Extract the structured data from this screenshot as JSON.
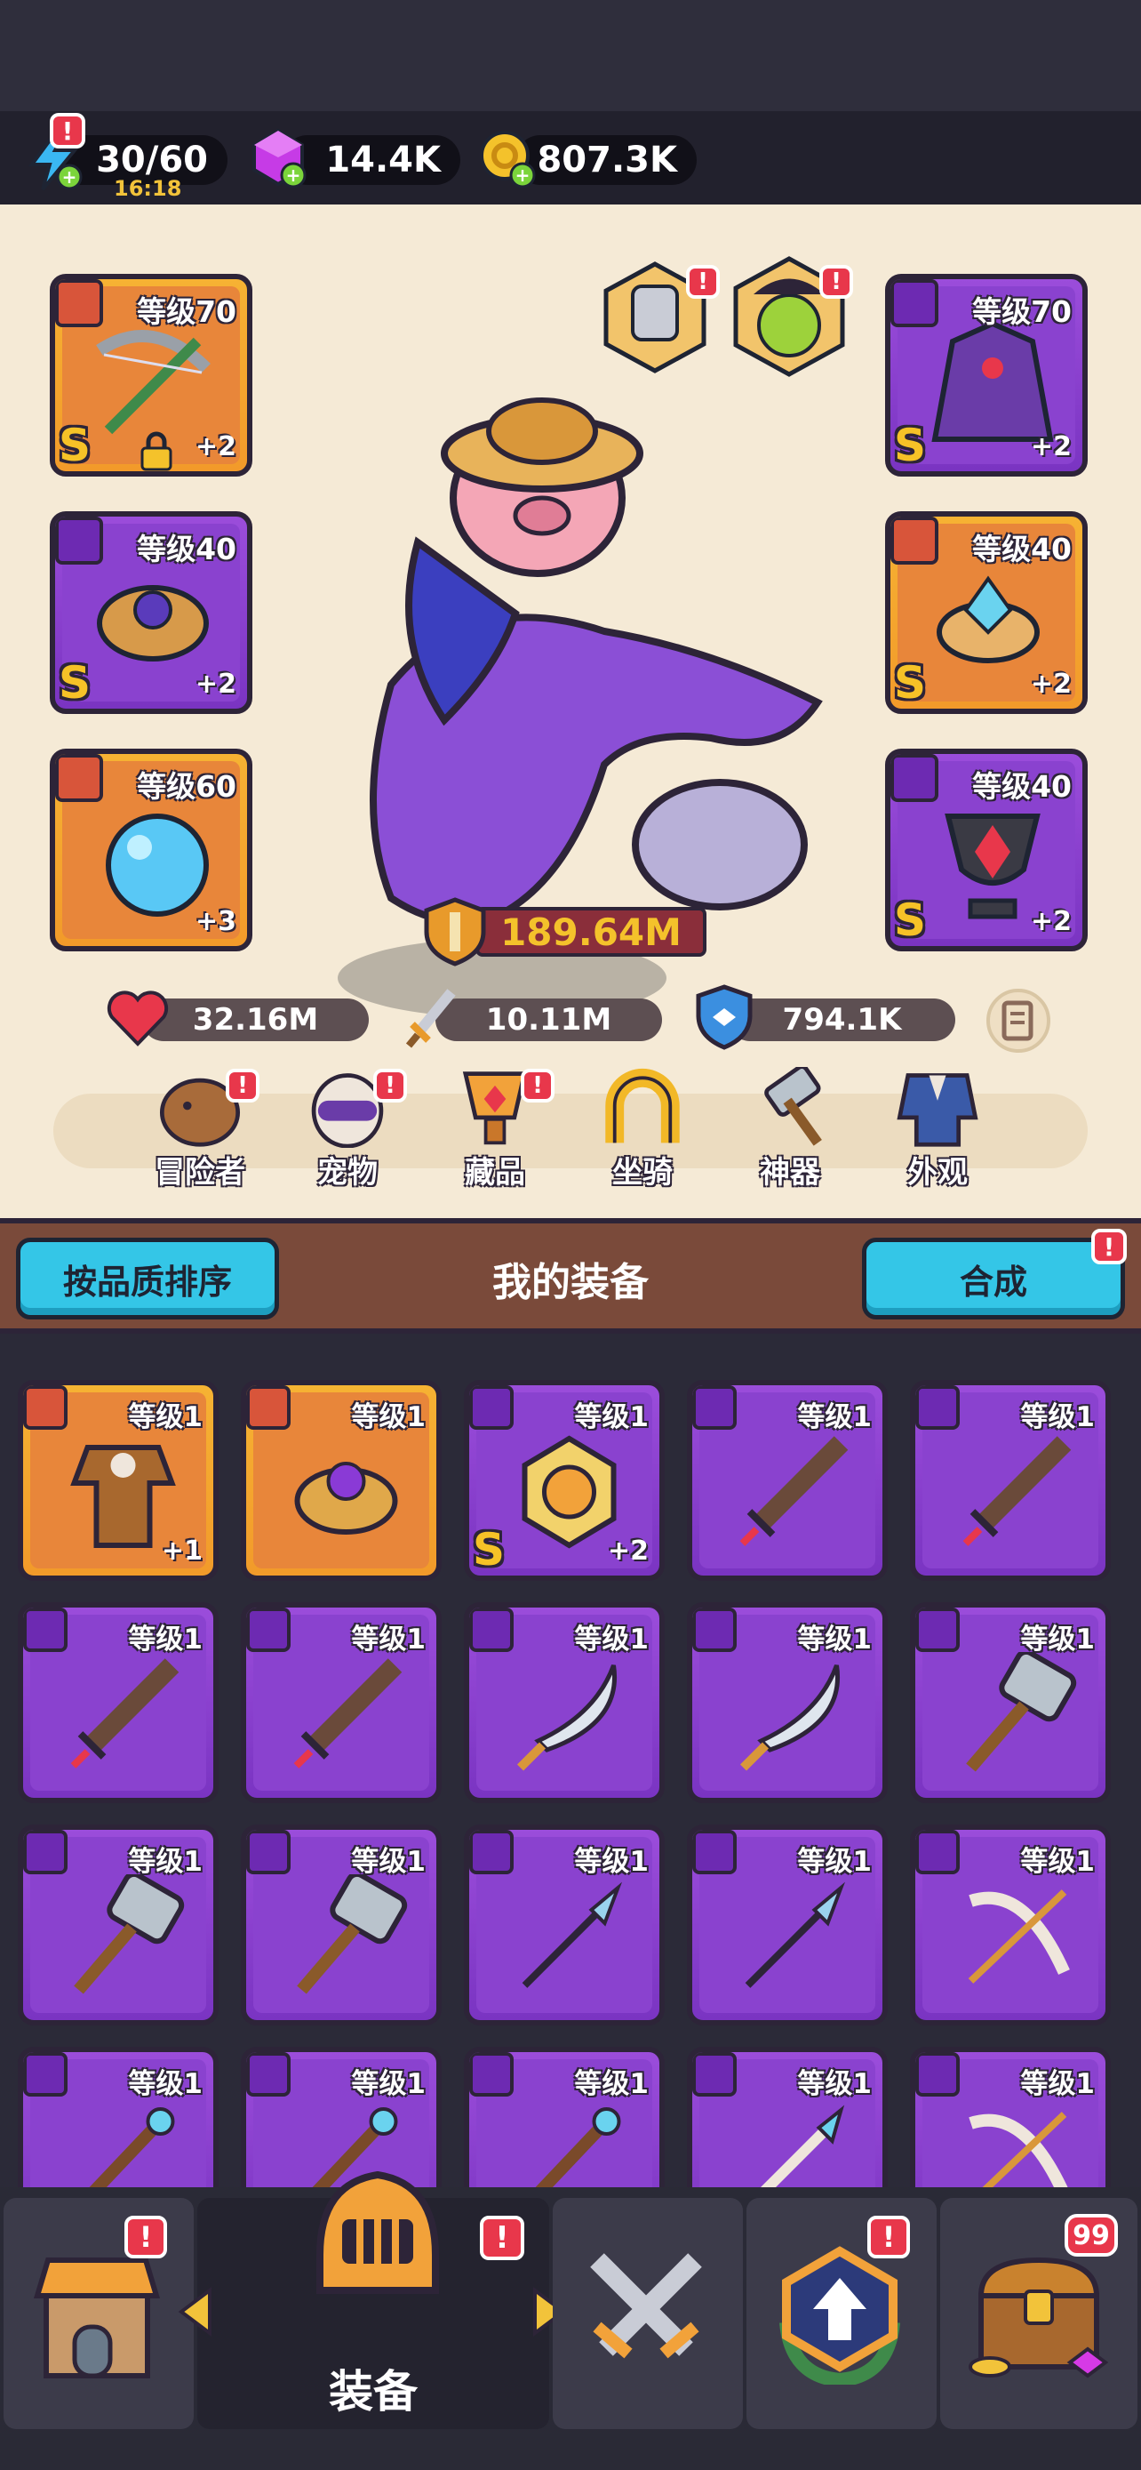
{
  "resources": {
    "energy": "30/60",
    "energy_timer": "16:18",
    "gems": "14.4K",
    "coins": "807.3K",
    "energy_badge": "!"
  },
  "hero": {
    "power": "189.64M",
    "hp": "32.16M",
    "attack": "10.11M",
    "defense": "794.1K",
    "equipped": [
      {
        "level": "等级70",
        "plus": "+2",
        "grade": "S",
        "quality": "gold",
        "icon": "crossbow-icon",
        "locked": true
      },
      {
        "level": "等级40",
        "plus": "+2",
        "grade": "S",
        "quality": "purple",
        "icon": "ring-icon"
      },
      {
        "level": "等级60",
        "plus": "+3",
        "grade": "",
        "quality": "gold",
        "icon": "orb-icon"
      },
      {
        "level": "等级70",
        "plus": "+2",
        "grade": "S",
        "quality": "purple",
        "icon": "cloak-icon"
      },
      {
        "level": "等级40",
        "plus": "+2",
        "grade": "S",
        "quality": "gold",
        "icon": "crystal-ring-icon"
      },
      {
        "level": "等级40",
        "plus": "+2",
        "grade": "S",
        "quality": "purple",
        "icon": "amulet-icon"
      }
    ],
    "menu": [
      "冒险者",
      "宠物",
      "藏品",
      "坐骑",
      "神器",
      "外观"
    ]
  },
  "equipment": {
    "sort_label": "按品质排序",
    "title": "我的装备",
    "merge_label": "合成",
    "items": [
      {
        "level": "等级1",
        "plus": "+1",
        "grade": "",
        "quality": "gold",
        "icon": "armor-icon"
      },
      {
        "level": "等级1",
        "plus": "",
        "grade": "",
        "quality": "gold",
        "icon": "ring-icon"
      },
      {
        "level": "等级1",
        "plus": "+2",
        "grade": "S",
        "quality": "purple",
        "icon": "medal-icon"
      },
      {
        "level": "等级1",
        "plus": "",
        "grade": "",
        "quality": "purple",
        "icon": "sword-icon"
      },
      {
        "level": "等级1",
        "plus": "",
        "grade": "",
        "quality": "purple",
        "icon": "sword-icon"
      },
      {
        "level": "等级1",
        "plus": "",
        "grade": "",
        "quality": "purple",
        "icon": "sword-icon"
      },
      {
        "level": "等级1",
        "plus": "",
        "grade": "",
        "quality": "purple",
        "icon": "sword-icon"
      },
      {
        "level": "等级1",
        "plus": "",
        "grade": "",
        "quality": "purple",
        "icon": "scimitar-icon"
      },
      {
        "level": "等级1",
        "plus": "",
        "grade": "",
        "quality": "purple",
        "icon": "scimitar-icon"
      },
      {
        "level": "等级1",
        "plus": "",
        "grade": "",
        "quality": "purple",
        "icon": "hammer-icon"
      },
      {
        "level": "等级1",
        "plus": "",
        "grade": "",
        "quality": "purple",
        "icon": "hammer-icon"
      },
      {
        "level": "等级1",
        "plus": "",
        "grade": "",
        "quality": "purple",
        "icon": "hammer-icon"
      },
      {
        "level": "等级1",
        "plus": "",
        "grade": "",
        "quality": "purple",
        "icon": "spear-icon"
      },
      {
        "level": "等级1",
        "plus": "",
        "grade": "",
        "quality": "purple",
        "icon": "spear-icon"
      },
      {
        "level": "等级1",
        "plus": "",
        "grade": "",
        "quality": "purple",
        "icon": "bow-icon"
      },
      {
        "level": "等级1",
        "plus": "",
        "grade": "",
        "quality": "purple",
        "icon": "staff-icon"
      },
      {
        "level": "等级1",
        "plus": "",
        "grade": "",
        "quality": "purple",
        "icon": "staff-icon"
      },
      {
        "level": "等级1",
        "plus": "",
        "grade": "",
        "quality": "purple",
        "icon": "staff-icon"
      },
      {
        "level": "等级1",
        "plus": "",
        "grade": "",
        "quality": "purple",
        "icon": "wand-icon"
      },
      {
        "level": "等级1",
        "plus": "",
        "grade": "",
        "quality": "purple",
        "icon": "bow-icon"
      }
    ]
  },
  "nav": {
    "active_label": "装备",
    "chest_count": "99",
    "badge": "!"
  },
  "colors": {
    "gold": "#f6b233",
    "purple": "#9b4ddb",
    "cyan_button": "#34c6e7",
    "badge_red": "#e8374b",
    "panel_bg": "#f5ead6"
  }
}
